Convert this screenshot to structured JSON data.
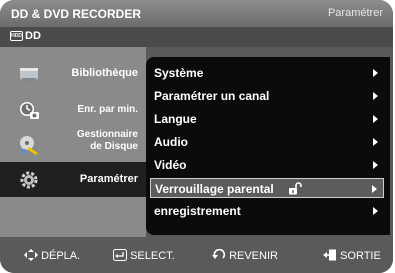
{
  "header": {
    "app_title": "DD & DVD RECORDER",
    "page_title": "Paramétrer"
  },
  "subheader": {
    "device_icon": "HDD",
    "device_label": "DD"
  },
  "sidebar": {
    "items": [
      {
        "label": "Bibliothèque",
        "icon": "library-icon"
      },
      {
        "label": "Enr. par min.",
        "icon": "timer-record-icon"
      },
      {
        "label_line1": "Gestionnaire",
        "label_line2": "de Disque",
        "icon": "disc-manager-icon"
      },
      {
        "label": "Paramétrer",
        "icon": "gear-icon",
        "selected": true
      }
    ]
  },
  "menu": {
    "items": [
      {
        "label": "Système"
      },
      {
        "label": "Paramétrer un canal"
      },
      {
        "label": "Langue"
      },
      {
        "label": "Audio"
      },
      {
        "label": "Vidéo"
      },
      {
        "label": "Verrouillage parental",
        "selected": true,
        "icon": "unlock-icon"
      },
      {
        "label": "enregistrement"
      }
    ]
  },
  "footer": {
    "move": "DÉPLA.",
    "select": "SELECT.",
    "back": "REVENIR",
    "exit": "SORTIE"
  },
  "colors": {
    "background": "#5a5a5a",
    "sidebar": "#8a8a8a",
    "panel": "#0b0b0b",
    "highlight": "#5c5c5c",
    "text": "#ffffff"
  }
}
